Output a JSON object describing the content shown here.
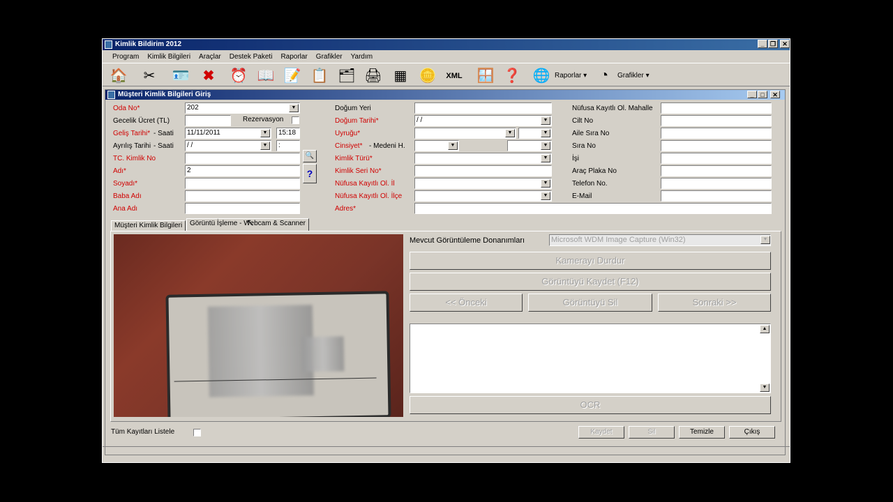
{
  "app": {
    "title": "Kimlik Bildirim 2012"
  },
  "menu": [
    "Program",
    "Kimlik Bilgileri",
    "Araçlar",
    "Destek Paketi",
    "Raporlar",
    "Grafikler",
    "Yardım"
  ],
  "toolbar": {
    "raporlar": "Raporlar",
    "grafikler": "Grafikler"
  },
  "child": {
    "title": "Müşteri Kimlik Bilgileri Giriş"
  },
  "form": {
    "oda_no": {
      "label": "Oda No*",
      "value": "202"
    },
    "gecelik": {
      "label": "Gecelik Ücret (TL)",
      "value": ""
    },
    "rezervasyon": {
      "label": "Rezervasyon"
    },
    "gelis": {
      "label1": "Geliş Tarihi*",
      "label2": "- Saati",
      "date": "11/11/2011",
      "time": "15:18"
    },
    "ayrilis": {
      "label1": "Ayrılış Tarihi",
      "label2": "- Saati",
      "date": " / /",
      "time": " :"
    },
    "tc": {
      "label": "TC. Kimlik No",
      "value": ""
    },
    "adi": {
      "label": "Adı*",
      "value": "2"
    },
    "soyadi": {
      "label": "Soyadı*",
      "value": ""
    },
    "baba": {
      "label": "Baba Adı",
      "value": ""
    },
    "ana": {
      "label": "Ana Adı",
      "value": ""
    },
    "dogum_yeri": {
      "label": "Doğum Yeri",
      "value": ""
    },
    "dogum_tarihi": {
      "label": "Doğum Tarihi*",
      "value": " / /"
    },
    "uyrugu": {
      "label": "Uyruğu*"
    },
    "cinsiyet": {
      "label1": "Cinsiyet*",
      "label2": "- Medeni H."
    },
    "kimlik_turu": {
      "label": "Kimlik Türü*"
    },
    "kimlik_seri": {
      "label": "Kimlik Seri No*"
    },
    "nufus_il": {
      "label": "Nüfusa Kayıtlı Ol. İl"
    },
    "nufus_ilce": {
      "label": "Nüfusa Kayıtlı Ol. İlçe"
    },
    "adres": {
      "label": "Adres*"
    },
    "mahalle": {
      "label": "Nüfusa Kayıtlı Ol. Mahalle"
    },
    "cilt": {
      "label": "Cilt No"
    },
    "aile_sira": {
      "label": "Aile Sıra No"
    },
    "sira": {
      "label": "Sıra No"
    },
    "isi": {
      "label": "İşi"
    },
    "plaka": {
      "label": "Araç Plaka No"
    },
    "telefon": {
      "label": "Telefon No."
    },
    "email": {
      "label": "E-Mail"
    }
  },
  "tabs": [
    "Müşteri Kimlik Bilgileri",
    "Görüntü İşleme - Webcam & Scanner"
  ],
  "imaging": {
    "device_label": "Mevcut Görüntüleme Donanımları",
    "device_value": "Microsoft WDM Image Capture (Win32)",
    "stop": "Kamerayı Durdur",
    "save": "Görüntüyü Kaydet  (F12)",
    "prev": "<< Önceki",
    "delete": "Görüntüyü Sil",
    "next": "Sonraki >>",
    "ocr": "OCR"
  },
  "bottom": {
    "list_all": "Tüm Kayıtları Listele",
    "kaydet": "Kaydet",
    "sil": "Sil",
    "temizle": "Temizle",
    "cikis": "Çıkış"
  },
  "colors": {
    "title_dark": "#0a246a",
    "required_label": "#d00000",
    "face": "#d4d0c8"
  }
}
